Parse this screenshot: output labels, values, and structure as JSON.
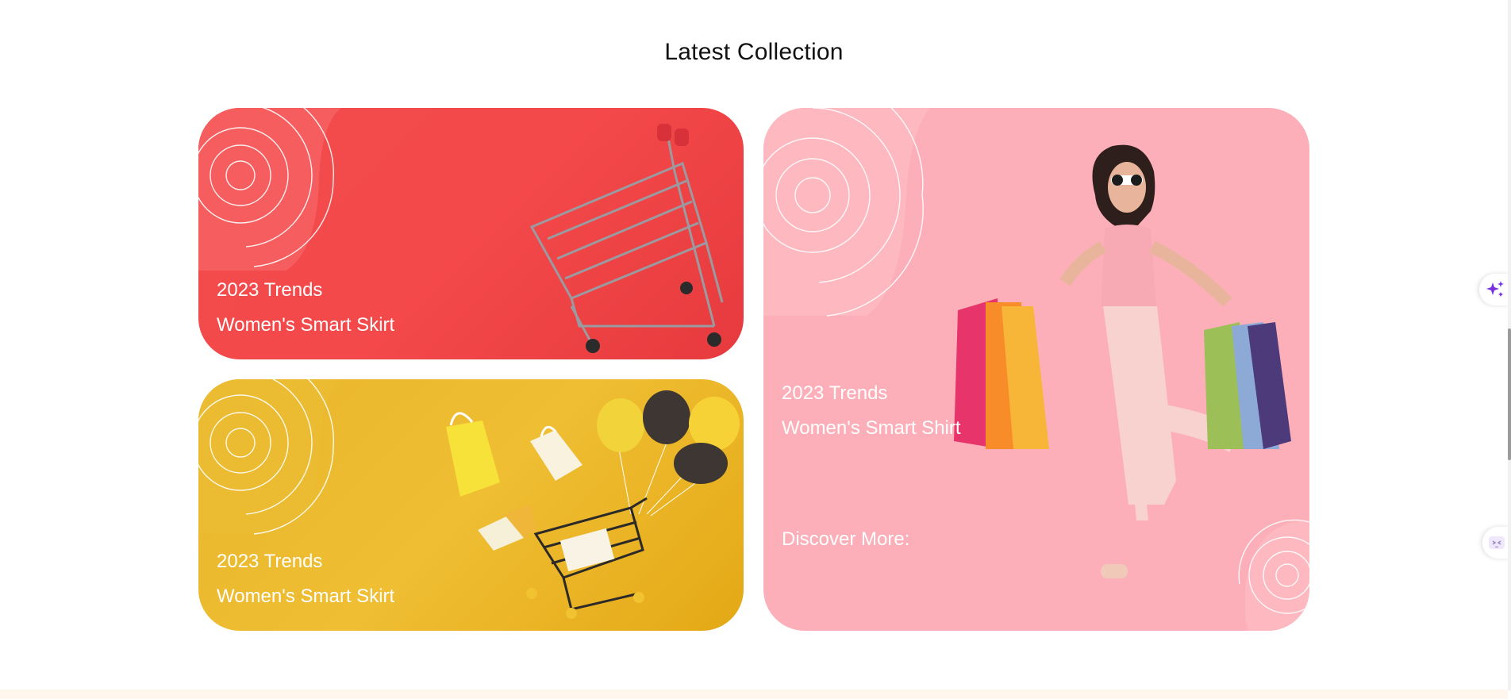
{
  "section": {
    "title": "Latest Collection"
  },
  "cards": [
    {
      "line1": "2023 Trends",
      "line2": "Women's Smart Skirt",
      "color": "#f4494a"
    },
    {
      "line1": "2023 Trends",
      "line2": "Women's Smart Skirt",
      "color": "#efbe33"
    },
    {
      "line1": "2023 Trends",
      "line2": "Women's Smart Shirt",
      "cta": "Discover More:",
      "color": "#fcafb8"
    }
  ],
  "icons": {
    "ai_assistant": "sparkle-icon",
    "chat_widget": "chat-face-icon"
  },
  "colors": {
    "title": "#111111",
    "sparkle": "#7b2fe0",
    "footer": "#fff6ee"
  }
}
